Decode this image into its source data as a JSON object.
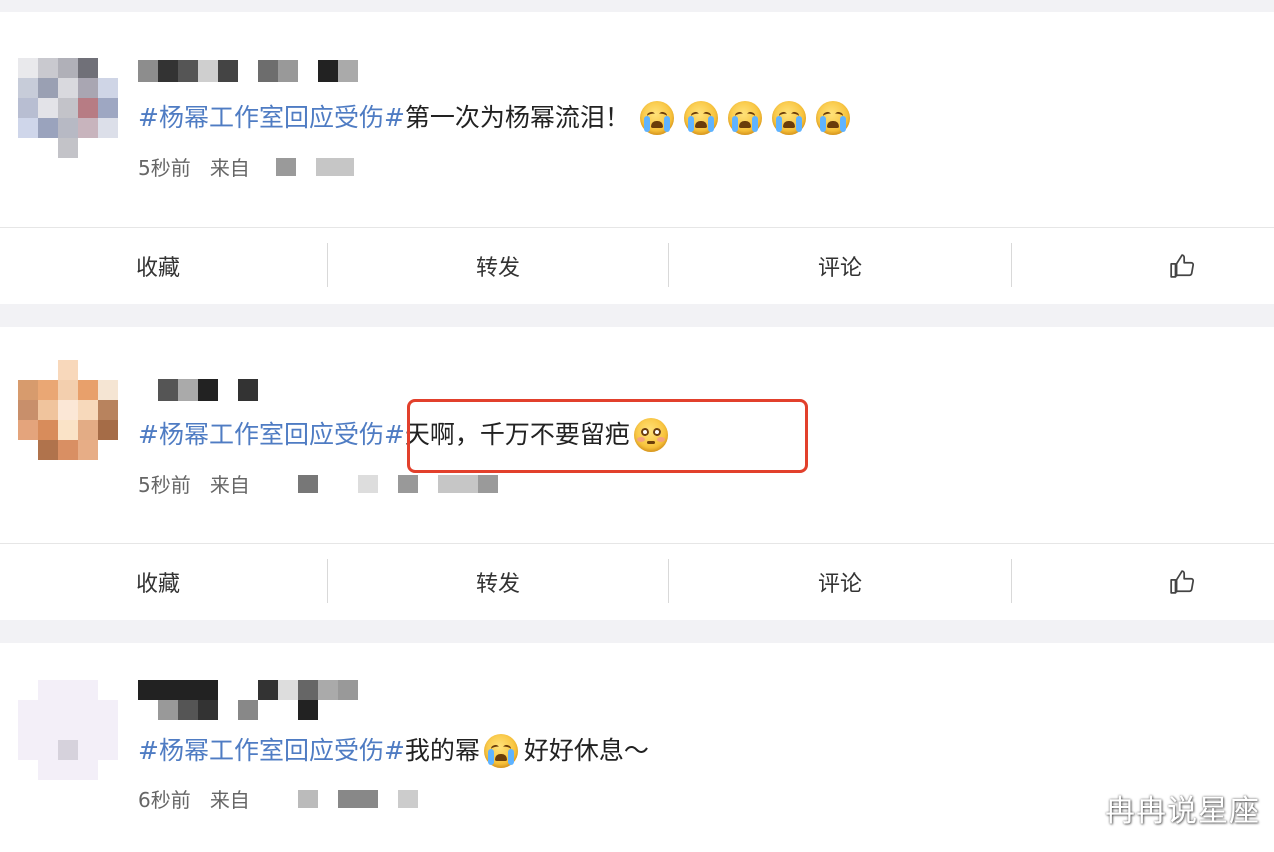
{
  "posts": [
    {
      "hashtag": "#杨幂工作室回应受伤#",
      "text": "第一次为杨幂流泪！",
      "emojis": [
        "crying-face-icon",
        "crying-face-icon",
        "crying-face-icon",
        "crying-face-icon",
        "crying-face-icon"
      ],
      "time": "5秒前",
      "source_prefix": "来自"
    },
    {
      "hashtag": "#杨幂工作室回应受伤#",
      "text": "天啊，千万不要留疤",
      "emojis": [
        "flushed-face-icon"
      ],
      "time": "5秒前",
      "source_prefix": "来自"
    },
    {
      "hashtag": "#杨幂工作室回应受伤#",
      "text_before": "我的幂",
      "text_after": "好好休息～",
      "emojis": [
        "crying-face-icon"
      ],
      "time": "6秒前",
      "source_prefix": "来自"
    }
  ],
  "actions": {
    "favorite": "收藏",
    "repost": "转发",
    "comment": "评论",
    "like_icon": "thumbs-up-icon"
  },
  "watermark": "冉冉说星座",
  "colors": {
    "hashtag": "#4f7cc3",
    "highlight": "#e2402c"
  }
}
